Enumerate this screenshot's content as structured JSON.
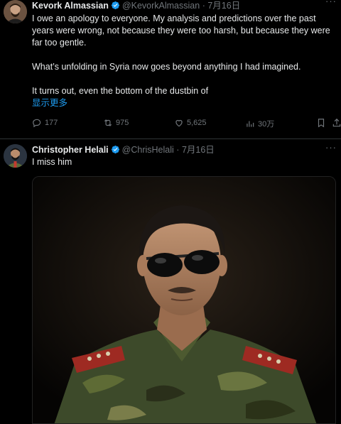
{
  "tweet1": {
    "author_name": "Kevork Almassian",
    "author_handle": "@KevorkAlmassian",
    "separator": "·",
    "date": "7月16日",
    "lines": [
      "I owe an apology to everyone. My analysis and predictions over the past",
      "years were wrong, not because they were too harsh, but because they were",
      "far too gentle.",
      "",
      "What’s unfolding in Syria now goes beyond anything I had imagined.",
      "",
      "It turns out, even the bottom of the dustbin of"
    ],
    "show_more": "显示更多",
    "replies": "177",
    "retweets": "975",
    "likes": "5,625",
    "views": "30万"
  },
  "tweet2": {
    "author_name": "Christopher Helali",
    "author_handle": "@ChrisHelali",
    "separator": "·",
    "date": "7月16日",
    "text": "I miss him"
  },
  "colors": {
    "background": "#000000",
    "text": "#e7e9ea",
    "muted": "#71767b",
    "link": "#1d9bf0",
    "verified": "#1d9bf0"
  },
  "icons": [
    "verified-badge-icon",
    "more-icon",
    "reply-icon",
    "retweet-icon",
    "like-icon",
    "views-icon",
    "bookmark-icon",
    "share-icon"
  ]
}
